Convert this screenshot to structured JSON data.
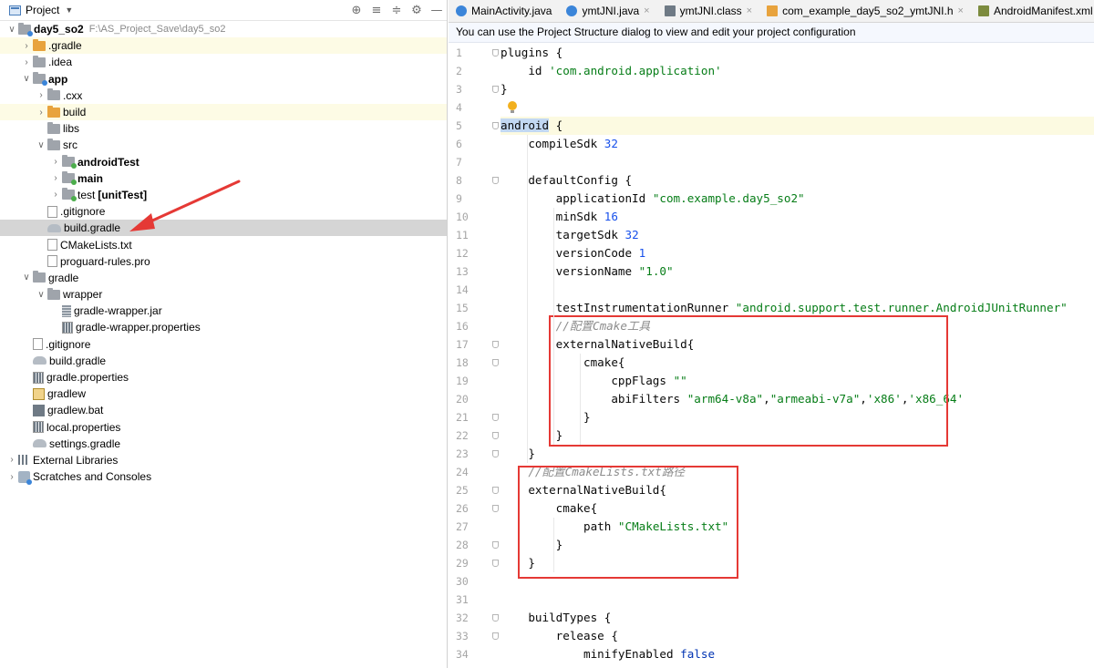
{
  "project_panel": {
    "title": "Project",
    "tools": [
      "⊕",
      "≡",
      "≑",
      "⚙",
      "—"
    ],
    "tree": [
      {
        "depth": 0,
        "arrow": "down",
        "icon": "module",
        "label": "day5_so2",
        "bold": true,
        "hint": "F:\\AS_Project_Save\\day5_so2"
      },
      {
        "depth": 1,
        "arrow": "right",
        "icon": "folder-orange",
        "label": ".gradle",
        "excluded": true
      },
      {
        "depth": 1,
        "arrow": "right",
        "icon": "folder",
        "label": ".idea"
      },
      {
        "depth": 1,
        "arrow": "down",
        "icon": "module",
        "label": "app",
        "bold": true
      },
      {
        "depth": 2,
        "arrow": "right",
        "icon": "folder",
        "label": ".cxx"
      },
      {
        "depth": 2,
        "arrow": "right",
        "icon": "folder-orange",
        "label": "build",
        "excluded": true
      },
      {
        "depth": 2,
        "arrow": "none",
        "icon": "folder",
        "label": "libs"
      },
      {
        "depth": 2,
        "arrow": "down",
        "icon": "folder",
        "label": "src"
      },
      {
        "depth": 3,
        "arrow": "right",
        "icon": "src",
        "label": "androidTest",
        "bold": true
      },
      {
        "depth": 3,
        "arrow": "right",
        "icon": "src",
        "label": "main",
        "bold": true
      },
      {
        "depth": 3,
        "arrow": "right",
        "icon": "src",
        "label": "test",
        "hint_bold": "[unitTest]"
      },
      {
        "depth": 2,
        "arrow": "none",
        "icon": "file",
        "label": ".gitignore"
      },
      {
        "depth": 2,
        "arrow": "none",
        "icon": "gradle-ico",
        "label": "build.gradle",
        "selected": true
      },
      {
        "depth": 2,
        "arrow": "none",
        "icon": "file",
        "label": "CMakeLists.txt"
      },
      {
        "depth": 2,
        "arrow": "none",
        "icon": "file",
        "label": "proguard-rules.pro"
      },
      {
        "depth": 1,
        "arrow": "down",
        "icon": "folder",
        "label": "gradle"
      },
      {
        "depth": 2,
        "arrow": "down",
        "icon": "folder",
        "label": "wrapper"
      },
      {
        "depth": 3,
        "arrow": "none",
        "icon": "jar",
        "label": "gradle-wrapper.jar"
      },
      {
        "depth": 3,
        "arrow": "none",
        "icon": "prop",
        "label": "gradle-wrapper.properties"
      },
      {
        "depth": 1,
        "arrow": "none",
        "icon": "file",
        "label": ".gitignore"
      },
      {
        "depth": 1,
        "arrow": "none",
        "icon": "gradle-ico",
        "label": "build.gradle"
      },
      {
        "depth": 1,
        "arrow": "none",
        "icon": "prop",
        "label": "gradle.properties"
      },
      {
        "depth": 1,
        "arrow": "none",
        "icon": "sh",
        "label": "gradlew"
      },
      {
        "depth": 1,
        "arrow": "none",
        "icon": "bat",
        "label": "gradlew.bat"
      },
      {
        "depth": 1,
        "arrow": "none",
        "icon": "prop",
        "label": "local.properties"
      },
      {
        "depth": 1,
        "arrow": "none",
        "icon": "gradle-ico",
        "label": "settings.gradle"
      },
      {
        "depth": 0,
        "arrow": "right",
        "icon": "bars",
        "label": "External Libraries"
      },
      {
        "depth": 0,
        "arrow": "right",
        "icon": "console",
        "label": "Scratches and Consoles"
      }
    ]
  },
  "tabs": [
    {
      "label": "MainActivity.java",
      "icon": "c",
      "close": false
    },
    {
      "label": "ymtJNI.java",
      "icon": "c",
      "close": true
    },
    {
      "label": "ymtJNI.class",
      "icon": "cls",
      "close": true
    },
    {
      "label": "com_example_day5_so2_ymtJNI.h",
      "icon": "h",
      "close": true
    },
    {
      "label": "AndroidManifest.xml",
      "icon": "mf",
      "close": false
    }
  ],
  "notice": "You can use the Project Structure dialog to view and edit your project configuration",
  "code": [
    {
      "n": "1",
      "fold": true,
      "parts": [
        [
          "plain",
          "plugins {"
        ]
      ]
    },
    {
      "n": "2",
      "parts": [
        [
          "plain",
          "    id "
        ],
        [
          "str",
          "'com.android.application'"
        ]
      ]
    },
    {
      "n": "3",
      "fold": true,
      "parts": [
        [
          "plain",
          "}"
        ]
      ]
    },
    {
      "n": "4",
      "bulb": true,
      "parts": []
    },
    {
      "n": "5",
      "fold": true,
      "current": true,
      "parts": [
        [
          "hl",
          "android"
        ],
        [
          "plain",
          " {"
        ]
      ]
    },
    {
      "n": "6",
      "parts": [
        [
          "plain",
          "    compileSdk "
        ],
        [
          "num",
          "32"
        ]
      ]
    },
    {
      "n": "7",
      "parts": []
    },
    {
      "n": "8",
      "fold": true,
      "parts": [
        [
          "plain",
          "    defaultConfig {"
        ]
      ]
    },
    {
      "n": "9",
      "parts": [
        [
          "plain",
          "        applicationId "
        ],
        [
          "str",
          "\"com.example.day5_so2\""
        ]
      ]
    },
    {
      "n": "10",
      "parts": [
        [
          "plain",
          "        minSdk "
        ],
        [
          "num",
          "16"
        ]
      ]
    },
    {
      "n": "11",
      "parts": [
        [
          "plain",
          "        targetSdk "
        ],
        [
          "num",
          "32"
        ]
      ]
    },
    {
      "n": "12",
      "parts": [
        [
          "plain",
          "        versionCode "
        ],
        [
          "num",
          "1"
        ]
      ]
    },
    {
      "n": "13",
      "parts": [
        [
          "plain",
          "        versionName "
        ],
        [
          "str",
          "\"1.0\""
        ]
      ]
    },
    {
      "n": "14",
      "parts": []
    },
    {
      "n": "15",
      "parts": [
        [
          "plain",
          "        testInstrumentationRunner "
        ],
        [
          "str",
          "\"android.support.test.runner.AndroidJUnitRunner\""
        ]
      ]
    },
    {
      "n": "16",
      "parts": [
        [
          "cmt",
          "        //配置Cmake工具"
        ]
      ]
    },
    {
      "n": "17",
      "fold": true,
      "parts": [
        [
          "plain",
          "        externalNativeBuild{"
        ]
      ]
    },
    {
      "n": "18",
      "fold": true,
      "parts": [
        [
          "plain",
          "            cmake{"
        ]
      ]
    },
    {
      "n": "19",
      "parts": [
        [
          "plain",
          "                cppFlags "
        ],
        [
          "str",
          "\"\""
        ]
      ]
    },
    {
      "n": "20",
      "parts": [
        [
          "plain",
          "                abiFilters "
        ],
        [
          "str",
          "\"arm64-v8a\""
        ],
        [
          "plain",
          ","
        ],
        [
          "str",
          "\"armeabi-v7a\""
        ],
        [
          "plain",
          ","
        ],
        [
          "str",
          "'x86'"
        ],
        [
          "plain",
          ","
        ],
        [
          "str",
          "'x86_64'"
        ]
      ]
    },
    {
      "n": "21",
      "fold": true,
      "parts": [
        [
          "plain",
          "            }"
        ]
      ]
    },
    {
      "n": "22",
      "fold": true,
      "parts": [
        [
          "plain",
          "        }"
        ]
      ]
    },
    {
      "n": "23",
      "fold": true,
      "parts": [
        [
          "plain",
          "    }"
        ]
      ]
    },
    {
      "n": "24",
      "parts": [
        [
          "cmt",
          "    //配置CmakeLists.txt路径"
        ]
      ]
    },
    {
      "n": "25",
      "fold": true,
      "parts": [
        [
          "plain",
          "    externalNativeBuild{"
        ]
      ]
    },
    {
      "n": "26",
      "fold": true,
      "parts": [
        [
          "plain",
          "        cmake{"
        ]
      ]
    },
    {
      "n": "27",
      "parts": [
        [
          "plain",
          "            path "
        ],
        [
          "str",
          "\"CMakeLists.txt\""
        ]
      ]
    },
    {
      "n": "28",
      "fold": true,
      "parts": [
        [
          "plain",
          "        }"
        ]
      ]
    },
    {
      "n": "29",
      "fold": true,
      "parts": [
        [
          "plain",
          "    }"
        ]
      ]
    },
    {
      "n": "30",
      "parts": []
    },
    {
      "n": "31",
      "parts": []
    },
    {
      "n": "32",
      "fold": true,
      "parts": [
        [
          "plain",
          "    buildTypes {"
        ]
      ]
    },
    {
      "n": "33",
      "fold": true,
      "parts": [
        [
          "plain",
          "        release {"
        ]
      ]
    },
    {
      "n": "34",
      "parts": [
        [
          "plain",
          "            minifyEnabled "
        ],
        [
          "kw",
          "false"
        ]
      ]
    }
  ]
}
